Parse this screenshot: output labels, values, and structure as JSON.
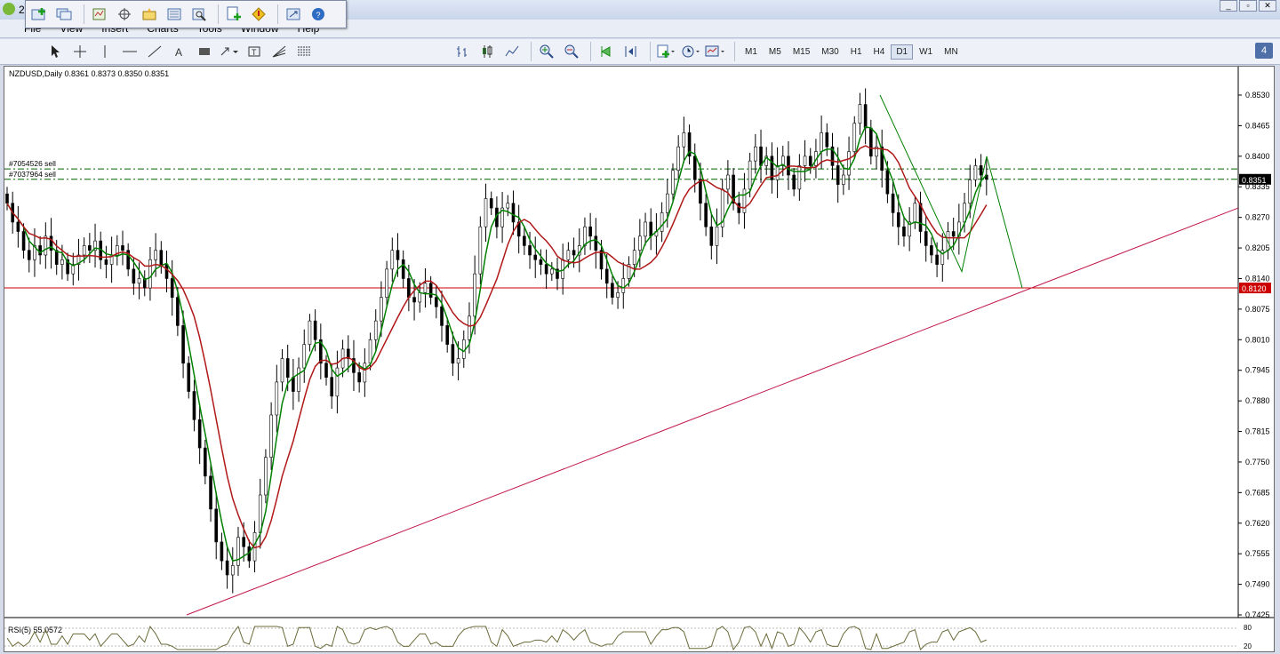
{
  "window": {
    "title_fragment": "2"
  },
  "menu": [
    "File",
    "View",
    "Insert",
    "Charts",
    "Tools",
    "Window",
    "Help"
  ],
  "timeframes": [
    "M1",
    "M5",
    "M15",
    "M30",
    "H1",
    "H4",
    "D1",
    "W1",
    "MN"
  ],
  "active_timeframe": "D1",
  "notification_badge": "4",
  "chart": {
    "header": "NZDUSD,Daily  0.8361 0.8373 0.8350 0.8351",
    "price_ticks": [
      "0.8530",
      "0.8465",
      "0.8400",
      "0.8335",
      "0.8270",
      "0.8205",
      "0.8140",
      "0.8075",
      "0.8010",
      "0.7945",
      "0.7880",
      "0.7815",
      "0.7750",
      "0.7685",
      "0.7620",
      "0.7555",
      "0.7490",
      "0.7425"
    ],
    "current_price": "0.8351",
    "level_price": "0.8120",
    "orders": [
      "#7054526 sell",
      "#7037964 sell"
    ],
    "rsi_label": "RSI(5) 55.0572",
    "rsi_levels": [
      "80",
      "20"
    ]
  },
  "colors": {
    "fast_ma": "#008000",
    "slow_ma": "#b01818",
    "level_line": "#cc0000",
    "trend_line": "#c0184a",
    "order_line": "#006400",
    "candle": "#000000"
  },
  "chart_data": {
    "type": "candlestick",
    "symbol": "NZDUSD",
    "timeframe": "Daily",
    "ohlc_last": {
      "open": 0.8361,
      "high": 0.8373,
      "low": 0.835,
      "close": 0.8351
    },
    "ylim": [
      0.7425,
      0.853
    ],
    "horizontal_level": 0.812,
    "order_levels": [
      0.8373,
      0.8351
    ],
    "trend_line": {
      "from": 0.7425,
      "to": 0.829
    },
    "zigzag": [
      0.853,
      0.8155,
      0.84,
      0.812
    ],
    "close_path": [
      0.83,
      0.826,
      0.824,
      0.82,
      0.818,
      0.821,
      0.819,
      0.823,
      0.82,
      0.817,
      0.818,
      0.815,
      0.817,
      0.819,
      0.821,
      0.82,
      0.822,
      0.818,
      0.817,
      0.819,
      0.821,
      0.82,
      0.816,
      0.813,
      0.814,
      0.812,
      0.818,
      0.82,
      0.817,
      0.814,
      0.81,
      0.804,
      0.796,
      0.79,
      0.784,
      0.778,
      0.772,
      0.765,
      0.758,
      0.754,
      0.751,
      0.753,
      0.759,
      0.757,
      0.754,
      0.76,
      0.768,
      0.776,
      0.785,
      0.792,
      0.797,
      0.793,
      0.79,
      0.795,
      0.8,
      0.805,
      0.801,
      0.796,
      0.793,
      0.789,
      0.795,
      0.799,
      0.797,
      0.794,
      0.792,
      0.796,
      0.801,
      0.805,
      0.81,
      0.816,
      0.82,
      0.818,
      0.814,
      0.81,
      0.809,
      0.811,
      0.813,
      0.81,
      0.808,
      0.804,
      0.8,
      0.796,
      0.797,
      0.801,
      0.806,
      0.815,
      0.825,
      0.831,
      0.829,
      0.825,
      0.829,
      0.83,
      0.826,
      0.823,
      0.821,
      0.819,
      0.818,
      0.817,
      0.815,
      0.816,
      0.814,
      0.818,
      0.82,
      0.819,
      0.821,
      0.825,
      0.823,
      0.82,
      0.816,
      0.813,
      0.81,
      0.811,
      0.814,
      0.817,
      0.82,
      0.823,
      0.826,
      0.823,
      0.824,
      0.828,
      0.832,
      0.837,
      0.842,
      0.845,
      0.84,
      0.835,
      0.83,
      0.825,
      0.821,
      0.825,
      0.833,
      0.836,
      0.83,
      0.828,
      0.833,
      0.839,
      0.842,
      0.838,
      0.84,
      0.835,
      0.838,
      0.84,
      0.836,
      0.833,
      0.838,
      0.84,
      0.838,
      0.841,
      0.845,
      0.842,
      0.838,
      0.834,
      0.836,
      0.841,
      0.847,
      0.851,
      0.846,
      0.84,
      0.842,
      0.837,
      0.832,
      0.828,
      0.825,
      0.823,
      0.826,
      0.83,
      0.824,
      0.821,
      0.819,
      0.817,
      0.82,
      0.824,
      0.823,
      0.826,
      0.83,
      0.835,
      0.838,
      0.836,
      0.8351
    ]
  }
}
